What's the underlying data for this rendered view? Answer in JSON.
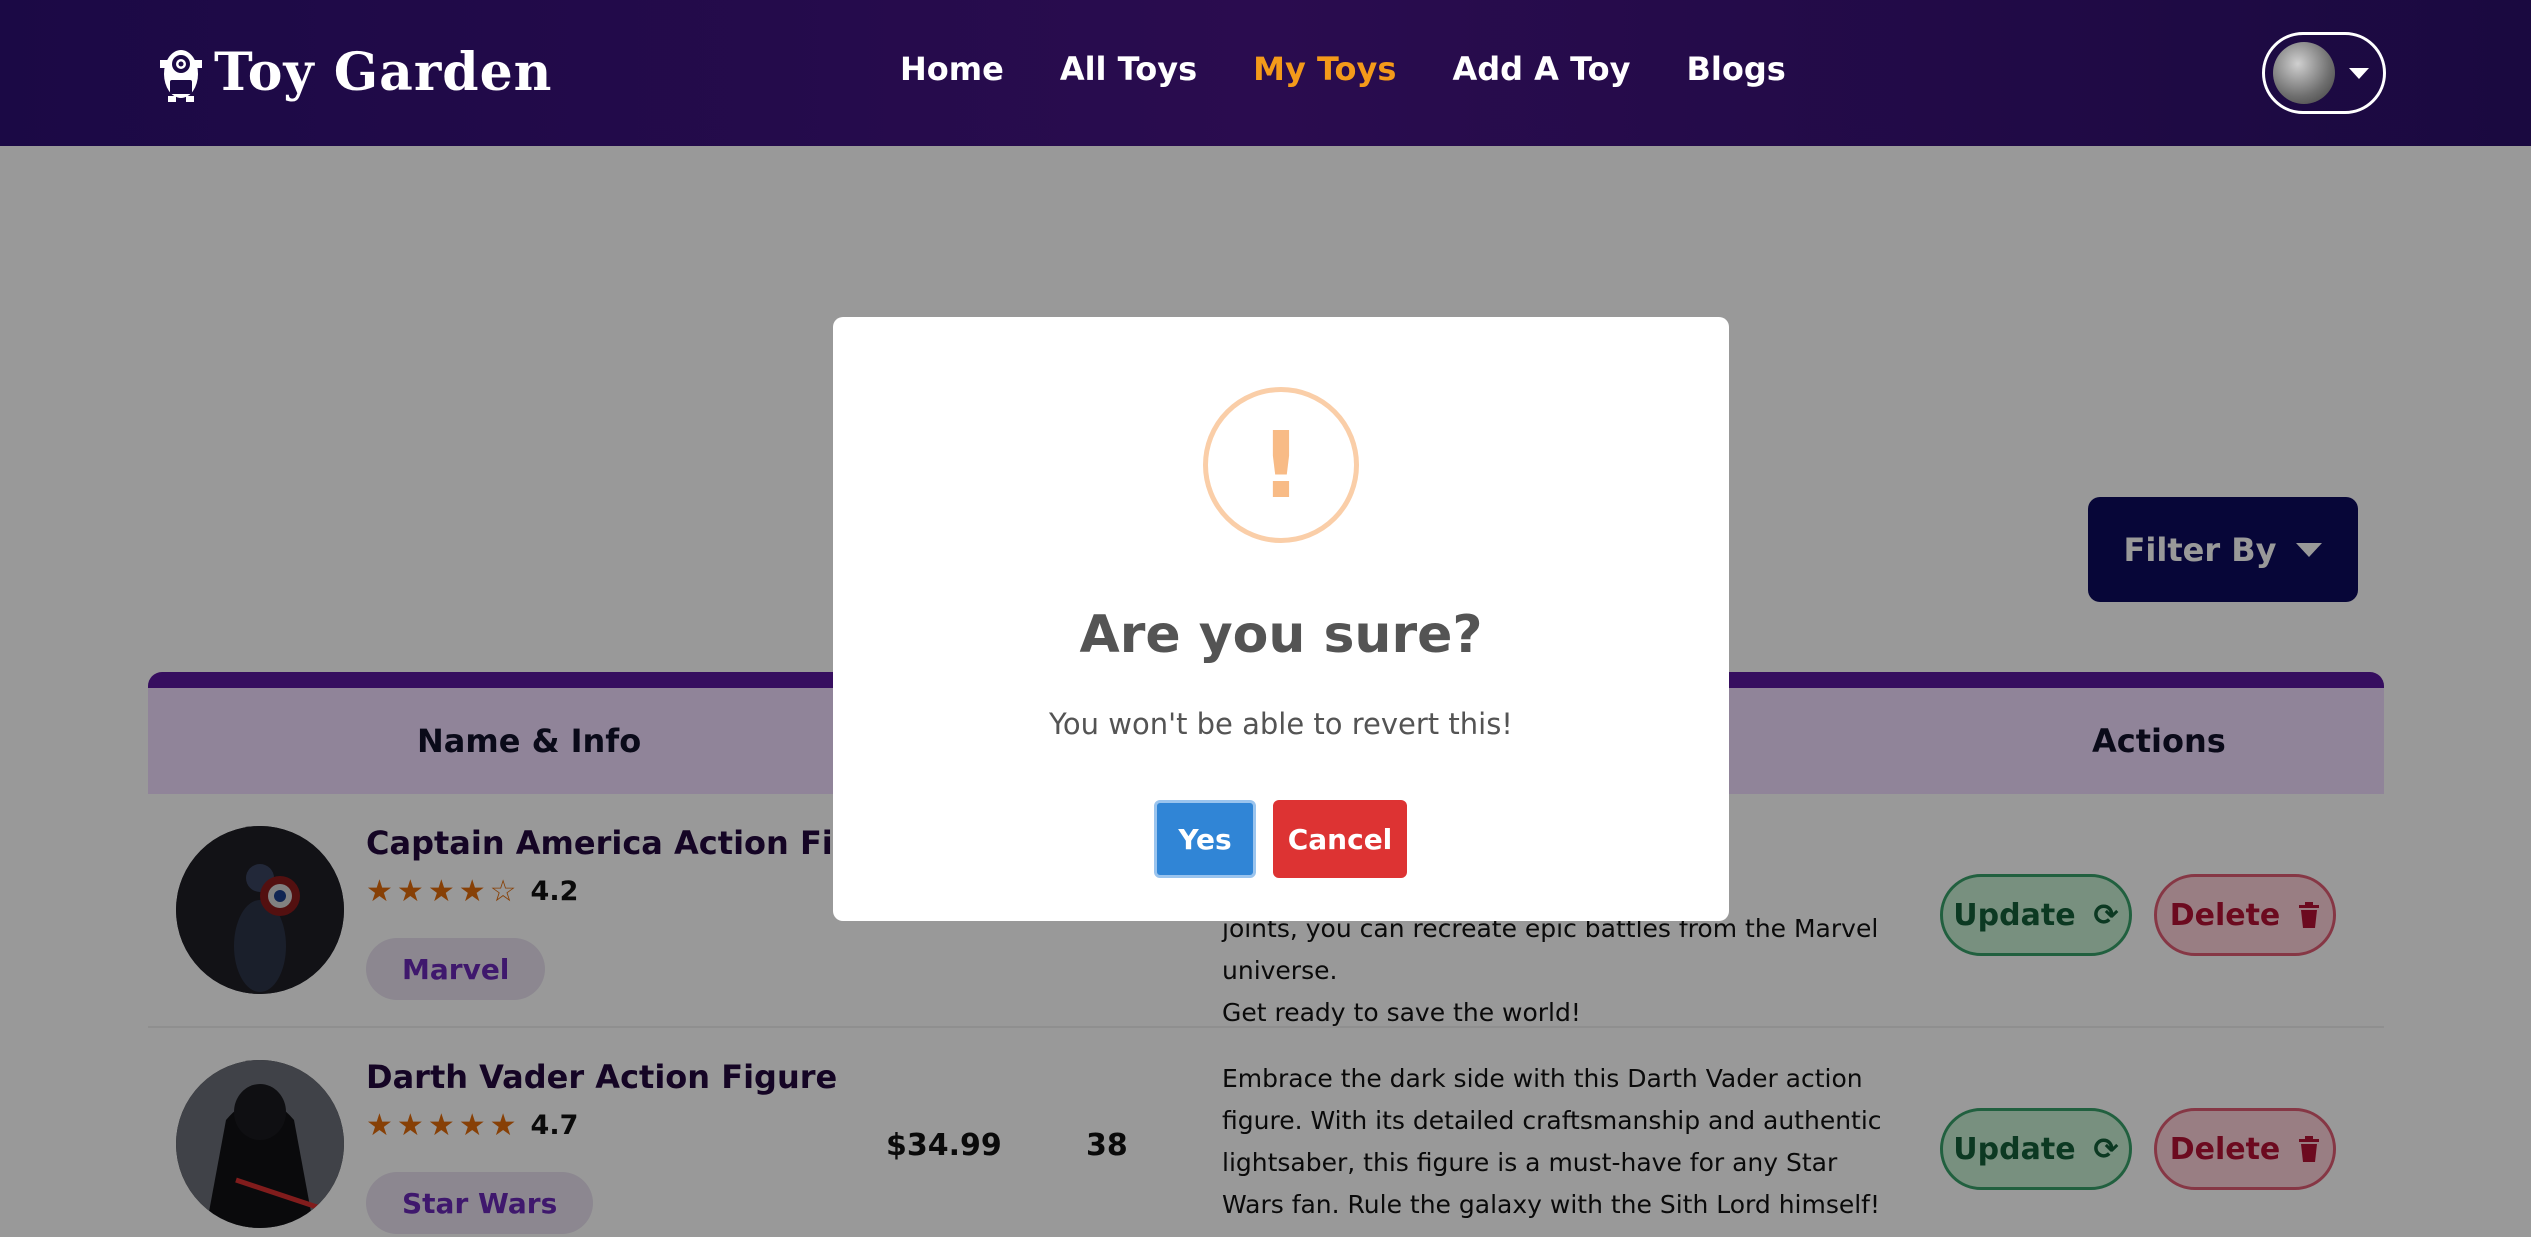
{
  "brand": {
    "name": "Toy Garden",
    "icon": "minion-logo-icon"
  },
  "nav": {
    "links": [
      {
        "label": "Home",
        "active": false
      },
      {
        "label": "All Toys",
        "active": false
      },
      {
        "label": "My Toys",
        "active": true
      },
      {
        "label": "Add A Toy",
        "active": false
      },
      {
        "label": "Blogs",
        "active": false
      }
    ],
    "active_color": "#f49a1a"
  },
  "filter": {
    "label": "Filter By"
  },
  "table": {
    "headers": {
      "name_info": "Name & Info",
      "actions": "Actions"
    },
    "rows": [
      {
        "name": "Captain America Action Figure",
        "rating": "4.2",
        "rating_value": 4.2,
        "brand": "Marvel",
        "price": "",
        "quantity": "",
        "description": "aptain\nposeable\njoints, you can recreate epic battles from the Marvel universe.\nGet ready to save the world!",
        "update_label": "Update",
        "delete_label": "Delete"
      },
      {
        "name": "Darth Vader Action Figure",
        "rating": "4.7",
        "rating_value": 4.7,
        "brand": "Star Wars",
        "price": "$34.99",
        "quantity": "38",
        "description": "Embrace the dark side with this Darth Vader action figure. With its detailed craftsmanship and authentic lightsaber, this figure is a must-have for any Star Wars fan. Rule the galaxy with the Sith Lord himself!",
        "update_label": "Update",
        "delete_label": "Delete"
      }
    ]
  },
  "modal": {
    "icon": "warning-exclamation-icon",
    "icon_glyph": "!",
    "title": "Are you sure?",
    "text": "You won't be able to revert this!",
    "confirm_label": "Yes",
    "cancel_label": "Cancel"
  },
  "colors": {
    "navbar": "#1b0945",
    "accent_purple": "#5b189e",
    "filter_button": "#0d0b5e",
    "confirm": "#3085d6",
    "cancel": "#dd3333",
    "warning": "#f8bb86"
  }
}
